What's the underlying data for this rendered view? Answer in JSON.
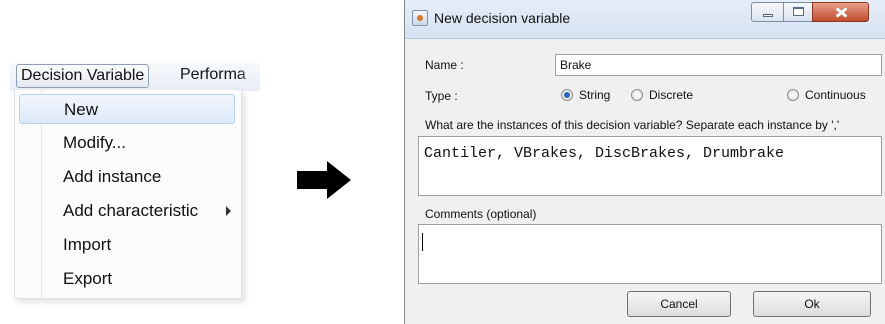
{
  "menu": {
    "bar_items": [
      "Decision Variable",
      "Performa"
    ],
    "items": [
      {
        "label": "New",
        "highlighted": true
      },
      {
        "label": "Modify..."
      },
      {
        "label": "Add instance"
      },
      {
        "label": "Add characteristic",
        "has_submenu": true
      },
      {
        "label": "Import"
      },
      {
        "label": "Export"
      }
    ]
  },
  "arrow": {
    "icon": "right-arrow-icon"
  },
  "dialog": {
    "title": "New decision variable",
    "name_label": "Name :",
    "name_value": "Brake",
    "type_label": "Type :",
    "type_options": [
      "String",
      "Discrete",
      "Continuous"
    ],
    "type_selected": "String",
    "instances_prompt": "What are the instances of this decision variable? Separate each instance by ','",
    "instances_value": "Cantiler, VBrakes, DiscBrakes, Drumbrake",
    "comments_label": "Comments (optional)",
    "comments_value": "",
    "cancel_label": "Cancel",
    "ok_label": "Ok"
  },
  "colors": {
    "menu_hover_bg": "#dde9f8",
    "titlebar_bg": "#d5e2f1",
    "close_button": "#c24b2c",
    "radio_selected": "#2c5fbf"
  }
}
